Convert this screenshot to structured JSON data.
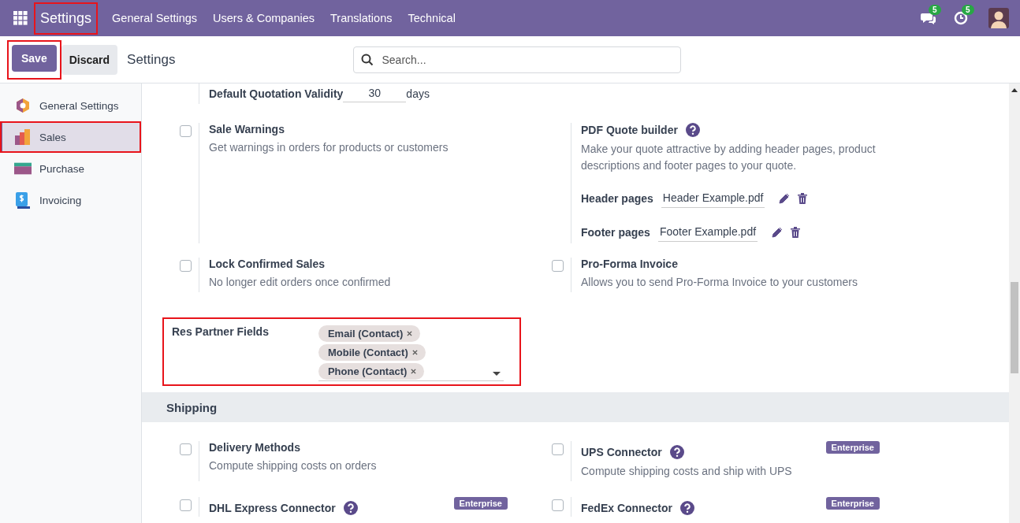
{
  "topbar": {
    "app_name": "Settings",
    "app_name_annotated": true,
    "menu": [
      "General Settings",
      "Users & Companies",
      "Translations",
      "Technical"
    ],
    "messages_count": "5",
    "activities_count": "5"
  },
  "control_panel": {
    "buttons": [
      {
        "label": "Save",
        "kind": "primary",
        "annotated": true
      },
      {
        "label": "Discard",
        "kind": "secondary",
        "annotated": false
      }
    ],
    "breadcrumb": "Settings",
    "search": {
      "placeholder": "Search..."
    }
  },
  "sidebar": {
    "items": [
      {
        "label": "General Settings",
        "kind": "general",
        "selected": false,
        "annotated": false
      },
      {
        "label": "Sales",
        "kind": "sales",
        "selected": true,
        "annotated": true
      },
      {
        "label": "Purchase",
        "kind": "purchase",
        "selected": false,
        "annotated": false
      },
      {
        "label": "Invoicing",
        "kind": "invoicing",
        "selected": false,
        "annotated": false
      }
    ]
  },
  "quotation_validity": {
    "label": "Default Quotation Validity",
    "value": "30",
    "unit": "days"
  },
  "settings": [
    {
      "kind": "checkbox",
      "title": "Sale Warnings",
      "description": "Get warnings in orders for products or customers",
      "checked": false
    },
    {
      "kind": "files",
      "title": "PDF Quote builder",
      "help": true,
      "description": "Make your quote attractive by adding header pages, product descriptions and footer pages to your quote.",
      "files": [
        {
          "label": "Header pages",
          "value": "Header Example.pdf"
        },
        {
          "label": "Footer pages",
          "value": "Footer Example.pdf"
        }
      ]
    },
    {
      "kind": "checkbox",
      "title": "Lock Confirmed Sales",
      "description": "No longer edit orders once confirmed",
      "checked": false
    },
    {
      "kind": "checkbox",
      "title": "Pro-Forma Invoice",
      "description": "Allows you to send Pro-Forma Invoice to your customers",
      "checked": false
    }
  ],
  "res_partner_fields": {
    "label": "Res Partner Fields",
    "annotated": true,
    "tags": [
      "Email (Contact)",
      "Mobile (Contact)",
      "Phone (Contact)"
    ]
  },
  "shipping": {
    "title": "Shipping",
    "settings": [
      {
        "kind": "checkbox",
        "title": "Delivery Methods",
        "description": "Compute shipping costs on orders",
        "checked": false
      },
      {
        "kind": "checkbox",
        "title": "UPS Connector",
        "help": true,
        "badge": "Enterprise",
        "description": "Compute shipping costs and ship with UPS",
        "checked": false
      },
      {
        "kind": "checkbox",
        "title": "DHL Express Connector",
        "help": true,
        "badge": "Enterprise",
        "checked": false
      },
      {
        "kind": "checkbox",
        "title": "FedEx Connector",
        "help": true,
        "badge": "Enterprise",
        "checked": false
      }
    ]
  }
}
